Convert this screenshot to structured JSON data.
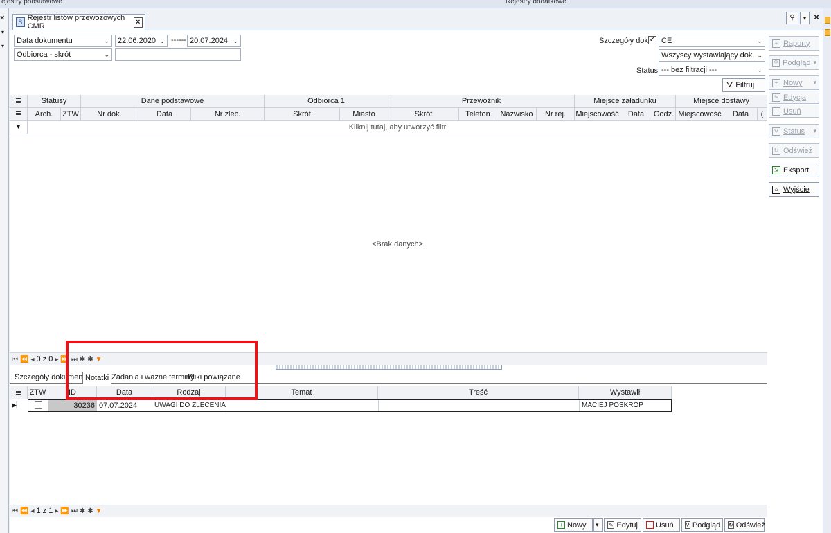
{
  "top": {
    "left_label": "ejestry podstawowe",
    "right_label": "Rejestry dodatkowe"
  },
  "window": {
    "tab_title": "Rejestr listów przewozowych CMR"
  },
  "filters": {
    "date_field": "Data dokumentu",
    "date_from": "22.06.2020",
    "date_sep": "------",
    "date_to": "20.07.2024",
    "recipient_field": "Odbiorca - skrót",
    "recipient_value": "",
    "details_label": "Szczegóły dok.",
    "details_value": "CE",
    "issuer_value": "Wszyscy wystawiający dok.",
    "status_label": "Status",
    "status_value": "--- bez filtracji ---",
    "filter_button": "Filtruj"
  },
  "side_buttons": [
    {
      "label": "Raporty",
      "enabled": false
    },
    {
      "label": "Podgląd",
      "enabled": false
    },
    {
      "label": "Nowy",
      "enabled": false
    },
    {
      "label": "Edycja",
      "enabled": false
    },
    {
      "label": "Usuń",
      "enabled": false
    },
    {
      "label": "Status",
      "enabled": false
    },
    {
      "label": "Odśwież",
      "enabled": false
    },
    {
      "label": "Eksport",
      "enabled": true
    },
    {
      "label": "Wyjście",
      "enabled": true
    }
  ],
  "grid": {
    "groups": [
      "Statusy",
      "Dane podstawowe",
      "Odbiorca 1",
      "Przewoźnik",
      "Miejsce załadunku",
      "Miejsce dostawy"
    ],
    "columns": [
      "Arch.",
      "ZTW",
      "Nr dok.",
      "Data",
      "Nr zlec.",
      "Skrót",
      "Miasto",
      "Skrót",
      "Telefon",
      "Nazwisko",
      "Nr rej.",
      "Miejscowość",
      "Data",
      "Godz.",
      "Miejscowość",
      "Data"
    ],
    "filter_hint": "Kliknij tutaj, aby utworzyć filtr",
    "empty": "<Brak danych>",
    "nav_count": "0 z 0"
  },
  "detail_tabs": [
    "Szczegóły dokumentu",
    "Notatki",
    "Zadania i ważne terminy",
    "Pliki powiązane"
  ],
  "notes": {
    "columns": [
      "ZTW",
      "ID",
      "Data",
      "Rodzaj",
      "Temat",
      "Treść",
      "Wystawił"
    ],
    "rows": [
      {
        "id": "30236",
        "date": "07.07.2024",
        "type": "UWAGI DO ZLECENIA",
        "subject": "",
        "content": "",
        "author": "MACIEJ POSKROP"
      }
    ],
    "nav_count": "1 z 1"
  },
  "bottom_buttons": [
    "Nowy",
    "Edytuj",
    "Usuń",
    "Podgląd",
    "Odśwież"
  ],
  "colors": {
    "highlight": "#e8141c",
    "filter_icon": "#f07b00"
  }
}
